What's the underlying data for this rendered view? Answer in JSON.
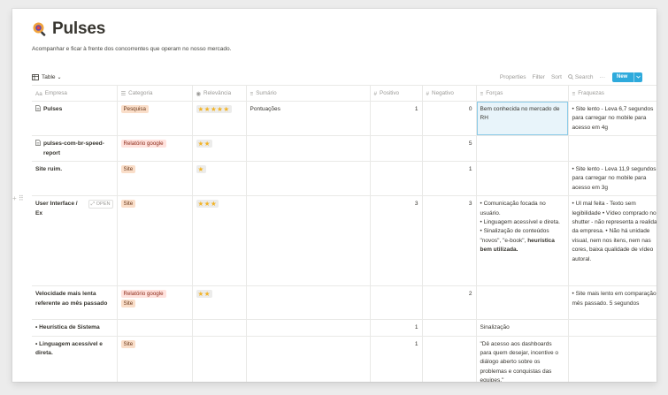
{
  "page": {
    "title": "Pulses",
    "subtitle": "Acompanhar e ficar à frente dos concorrentes que operam no nosso mercado."
  },
  "toolbar": {
    "view_label": "Table",
    "properties": "Properties",
    "filter": "Filter",
    "sort": "Sort",
    "search": "Search",
    "more": "···",
    "new_label": "New"
  },
  "columns": {
    "empresa": "Empresa",
    "categoria": "Categoria",
    "relevancia": "Relevância",
    "sumario": "Sumário",
    "positivo": "Positivo",
    "negativo": "Negativo",
    "forcas": "Forças",
    "fraquezas": "Fraquezas"
  },
  "rows": [
    {
      "empresa": "Pulses",
      "categoria": [
        "Pesquisa"
      ],
      "relevancia": "★★★★★",
      "sumario": "Pontuações",
      "positivo": "1",
      "negativo": "0",
      "forcas": "Bem conhecida no mercado de RH",
      "fraquezas": "• Site lento - Leva 6,7 segundos para carregar no mobile para acesso em 4g"
    },
    {
      "empresa": "pulses-com-br-speed-report",
      "categoria": [
        "Relatório google"
      ],
      "relevancia": "★★",
      "sumario": "",
      "positivo": "",
      "negativo": "5",
      "forcas": "",
      "fraquezas": ""
    },
    {
      "empresa": "Site ruim.",
      "categoria": [
        "Site"
      ],
      "relevancia": "★",
      "sumario": "",
      "positivo": "",
      "negativo": "1",
      "forcas": "",
      "fraquezas": "• Site lento - Leva 11,9 segundos para carregar no mobile para acesso em 3g"
    },
    {
      "empresa": "User Interface / Ex",
      "open": "OPEN",
      "categoria": [
        "Site"
      ],
      "relevancia": "★★★",
      "sumario": "",
      "positivo": "3",
      "negativo": "3",
      "forcas_lines": [
        "• Comunicação focada no usuário.",
        "• Linguagem acessível e direta.",
        "• Sinalização de conteúdos \"novos\", \"e-book\","
      ],
      "forcas_strong": "heurística bem utilizada.",
      "fraquezas": "• UI mal feita - Texto sem legibilidade • Vídeo comprado no shutter - não representa a realidade da empresa. • Não há unidade visual, nem nos itens, nem nas cores, baixa qualidade de vídeo autoral."
    },
    {
      "empresa": "Velocidade mais lenta referente ao mês passado",
      "categoria": [
        "Relatório google",
        "Site"
      ],
      "relevancia": "★★",
      "sumario": "",
      "positivo": "",
      "negativo": "2",
      "forcas": "",
      "fraquezas": "• Site mais lento em comparação ao mês passado. 5 segundos"
    },
    {
      "empresa": "• Heurística de Sistema",
      "categoria": [],
      "relevancia": "",
      "sumario": "",
      "positivo": "1",
      "negativo": "",
      "forcas": "Sinalização",
      "fraquezas": ""
    },
    {
      "empresa": "• Linguagem acessível e direta.",
      "categoria": [
        "Site"
      ],
      "relevancia": "",
      "sumario": "",
      "positivo": "1",
      "negativo": "",
      "forcas": "\"Dê acesso aos dashboards para quem desejar, incentive o diálogo aberto sobre os problemas e conquistas das equipes.\"",
      "fraquezas": ""
    }
  ],
  "colors": {
    "accent": "#2eaadc",
    "tag_orange": "#fadec9",
    "tag_red": "#ffe2dd",
    "star": "#f2b325",
    "highlight": "#e8f4fa"
  }
}
